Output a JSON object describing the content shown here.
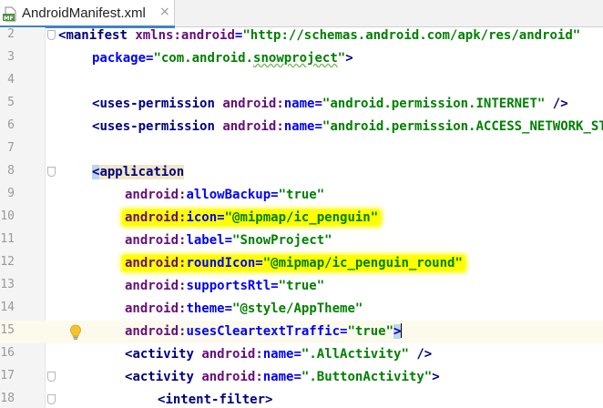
{
  "tab": {
    "label": "AndroidManifest.xml",
    "close": "×",
    "file_badge": "MF"
  },
  "lines": {
    "l2": {
      "n": "2",
      "lt": "<",
      "tag": "manifest",
      "ns": "xmlns:",
      "attr": "android",
      "eq": "=",
      "val": "\"http://schemas.android.com/apk/res/android\""
    },
    "l3": {
      "n": "3",
      "attr": "package",
      "eq": "=",
      "q1": "\"com.android.",
      "wavy": "snowproject",
      "q2": "\"",
      "end": ">"
    },
    "l4": {
      "n": "4"
    },
    "l5": {
      "n": "5",
      "lt": "<",
      "tag": "uses-permission",
      "ns": "android:",
      "attr": "name",
      "eq": "=",
      "val": "\"android.permission.INTERNET\"",
      "end": " />"
    },
    "l6": {
      "n": "6",
      "lt": "<",
      "tag": "uses-permission",
      "ns": "android:",
      "attr": "name",
      "eq": "=",
      "val": "\"android.permission.ACCESS_NETWORK_STATE\"",
      "end": " />"
    },
    "l7": {
      "n": "7"
    },
    "l8": {
      "n": "8",
      "lt": "<",
      "tag": "application"
    },
    "l9": {
      "n": "9",
      "ns": "android:",
      "attr": "allowBackup",
      "eq": "=",
      "val": "\"true\""
    },
    "l10": {
      "n": "10",
      "ns": "android:",
      "attr": "icon",
      "eq": "=",
      "val": "\"@mipmap/ic_penguin\""
    },
    "l11": {
      "n": "11",
      "ns": "android:",
      "attr": "label",
      "eq": "=",
      "val": "\"SnowProject\""
    },
    "l12": {
      "n": "12",
      "ns": "android:",
      "attr": "roundIcon",
      "eq": "=",
      "val": "\"@mipmap/ic_penguin_round\""
    },
    "l13": {
      "n": "13",
      "ns": "android:",
      "attr": "supportsRtl",
      "eq": "=",
      "val": "\"true\""
    },
    "l14": {
      "n": "14",
      "ns": "android:",
      "attr": "theme",
      "eq": "=",
      "val": "\"@style/AppTheme\""
    },
    "l15": {
      "n": "15",
      "ns": "android:",
      "attr": "usesCleartextTraffic",
      "eq": "=",
      "val": "\"true\"",
      "end": ">"
    },
    "l16": {
      "n": "16",
      "lt": "<",
      "tag": "activity",
      "ns": "android:",
      "attr": "name",
      "eq": "=",
      "val": "\".AllActivity\"",
      "end": " />"
    },
    "l17": {
      "n": "17",
      "lt": "<",
      "tag": "activity",
      "ns": "android:",
      "attr": "name",
      "eq": "=",
      "val": "\".ButtonActivity\"",
      "end": ">"
    },
    "l18": {
      "n": "18",
      "lt": "<",
      "tag": "intent-filter",
      "end": ">"
    }
  },
  "colors": {
    "highlight": "#ffff00",
    "current_line": "#fcfaed",
    "tag": "#000080",
    "attribute": "#0000ff",
    "namespace": "#660e7a",
    "value": "#008000"
  },
  "icons": {
    "file": "manifest-file-icon",
    "intention": "lightbulb-icon",
    "fold": "fold-marker-icon"
  }
}
